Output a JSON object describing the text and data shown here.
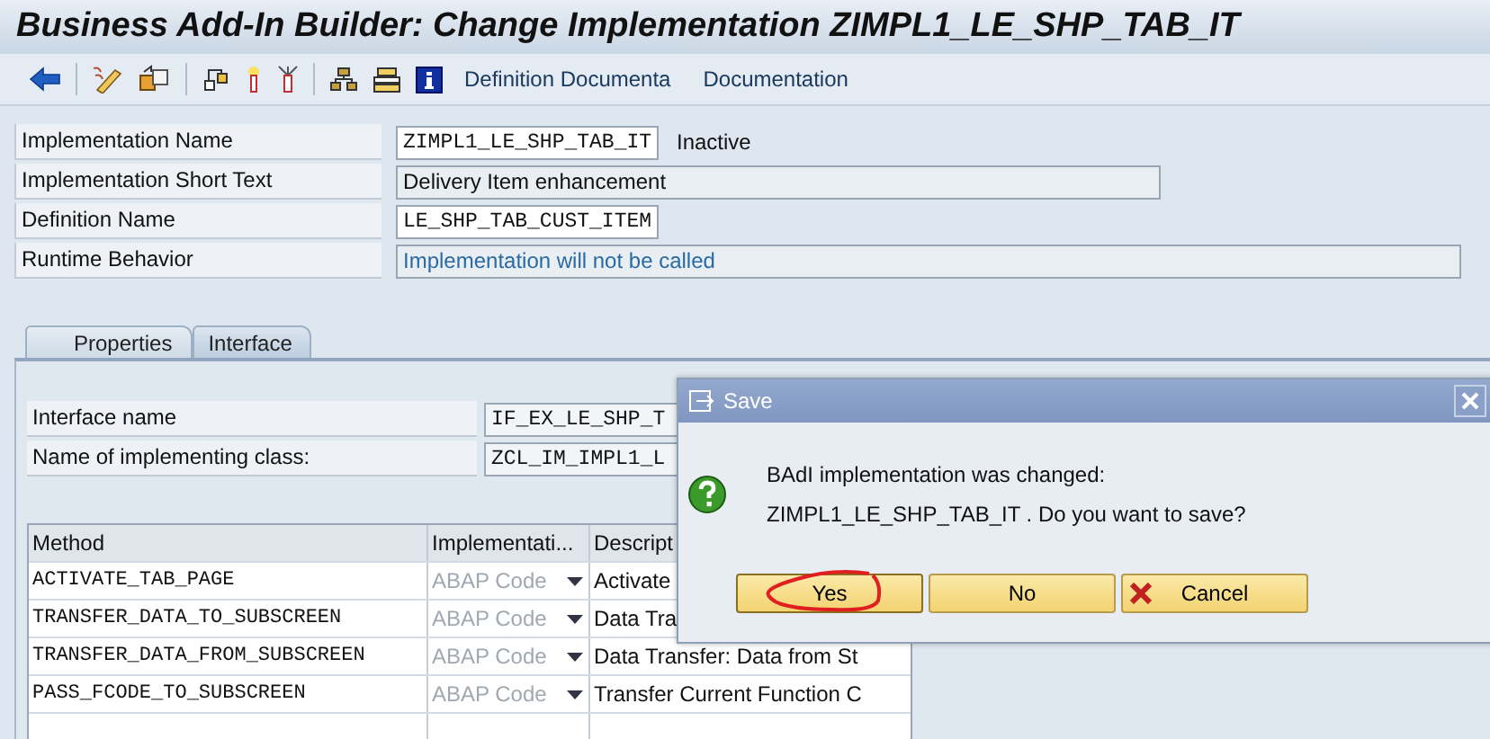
{
  "window": {
    "title": "Business Add-In Builder: Change Implementation ZIMPL1_LE_SHP_TAB_IT"
  },
  "toolbar": {
    "text_buttons": [
      "Definition Documenta",
      "Documentation"
    ]
  },
  "header_fields": [
    {
      "label": "Implementation Name",
      "value": "ZIMPL1_LE_SHP_TAB_IT",
      "kind": "code",
      "status": "Inactive"
    },
    {
      "label": "Implementation Short Text",
      "value": "Delivery Item enhancement",
      "kind": "text"
    },
    {
      "label": "Definition Name",
      "value": "LE_SHP_TAB_CUST_ITEM",
      "kind": "code"
    },
    {
      "label": "Runtime Behavior",
      "value": "Implementation will not be called",
      "kind": "info"
    }
  ],
  "tabs": [
    {
      "label": "Properties",
      "selected": false
    },
    {
      "label": "Interface",
      "selected": true
    }
  ],
  "interface_fields": [
    {
      "label": "Interface name",
      "value": "IF_EX_LE_SHP_T"
    },
    {
      "label": "Name of implementing class:",
      "value": "ZCL_IM_IMPL1_L"
    }
  ],
  "methods_table": {
    "columns": [
      "Method",
      "Implementati...",
      "Descript"
    ],
    "rows": [
      {
        "method": "ACTIVATE_TAB_PAGE",
        "implementation": "ABAP Code",
        "description": "Activate"
      },
      {
        "method": "TRANSFER_DATA_TO_SUBSCREEN",
        "implementation": "ABAP Code",
        "description": "Data Tra"
      },
      {
        "method": "TRANSFER_DATA_FROM_SUBSCREEN",
        "implementation": "ABAP Code",
        "description": "Data Transfer: Data from St"
      },
      {
        "method": "PASS_FCODE_TO_SUBSCREEN",
        "implementation": "ABAP Code",
        "description": "Transfer Current Function C"
      }
    ]
  },
  "dialog": {
    "title": "Save",
    "message_lines": [
      "BAdI implementation was changed:",
      "ZIMPL1_LE_SHP_TAB_IT . Do you want to save?"
    ],
    "buttons": [
      {
        "label": "Yes",
        "kind": "default",
        "circled": true
      },
      {
        "label": "No",
        "kind": "plain",
        "circled": false
      },
      {
        "label": "Cancel",
        "kind": "cancel",
        "circled": false
      }
    ]
  }
}
